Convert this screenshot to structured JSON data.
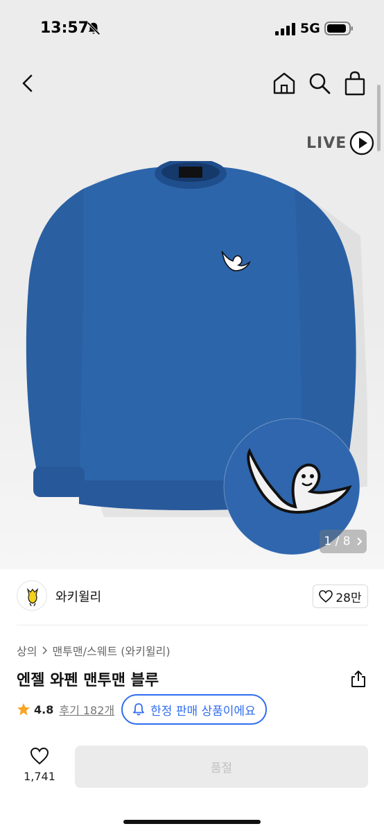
{
  "status_bar": {
    "time": "13:57",
    "network": "5G",
    "icons": [
      "bell-slash-icon",
      "signal-bars-icon",
      "battery-icon"
    ]
  },
  "nav": {
    "icons": [
      "back-chevron-icon",
      "home-icon",
      "search-icon",
      "shopping-bag-icon"
    ]
  },
  "live_badge": {
    "label": "LIVE",
    "icon": "play-circle-icon"
  },
  "gallery": {
    "indicator": "1 / 8",
    "next_icon": "chevron-right-icon",
    "colors": {
      "shirt": "#2c63a8",
      "logo": "#ffffff"
    }
  },
  "brand": {
    "name": "와키윌리",
    "logo_icon": "wacky-willy-logo",
    "likes": "28만",
    "like_icon": "heart-outline-icon"
  },
  "breadcrumb": {
    "items": [
      "상의",
      "맨투맨/스웨트 (와키윌리)"
    ],
    "separator_icon": "chevron-right-icon"
  },
  "product": {
    "title": "엔젤 와펜 맨투맨 블루",
    "share_icon": "share-icon",
    "rating": "4.8",
    "rating_icon": "star-icon",
    "reviews": "후기 182개",
    "limited_badge": "한정 판매 상품이에요",
    "limited_icon": "bell-icon",
    "accent_color": "#2f6cf0"
  },
  "bottom_bar": {
    "wish_count": "1,741",
    "wish_icon": "heart-outline-icon",
    "sold_out_label": "품절"
  }
}
